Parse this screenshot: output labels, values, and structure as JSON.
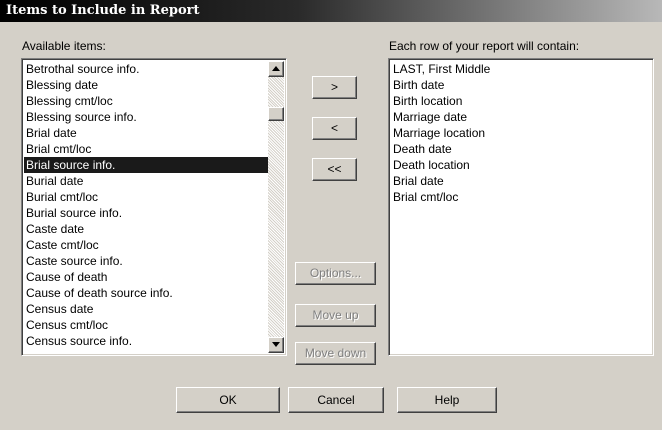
{
  "window": {
    "title": "Items to Include in Report"
  },
  "available": {
    "label": "Available items:",
    "items": [
      "Betrothal source info.",
      "Blessing date",
      "Blessing cmt/loc",
      "Blessing source info.",
      "Brial date",
      "Brial cmt/loc",
      "Brial source info.",
      "Burial date",
      "Burial cmt/loc",
      "Burial source info.",
      "Caste date",
      "Caste cmt/loc",
      "Caste source info.",
      "Cause of death",
      "Cause of death source info.",
      "Census date",
      "Census cmt/loc",
      "Census source info."
    ],
    "selected_item": "Brial source info."
  },
  "report": {
    "label": "Each row of your report will contain:",
    "items": [
      "LAST, First Middle",
      "Birth date",
      "Birth location",
      "Marriage date",
      "Marriage location",
      "Death date",
      "Death location",
      "Brial date",
      "Brial cmt/loc"
    ]
  },
  "transfer": {
    "add_label": ">",
    "remove_label": "<",
    "remove_all_label": "<<"
  },
  "actions": {
    "options_label": "Options...",
    "move_up_label": "Move up",
    "move_down_label": "Move down"
  },
  "footer": {
    "ok_label": "OK",
    "cancel_label": "Cancel",
    "help_label": "Help"
  }
}
